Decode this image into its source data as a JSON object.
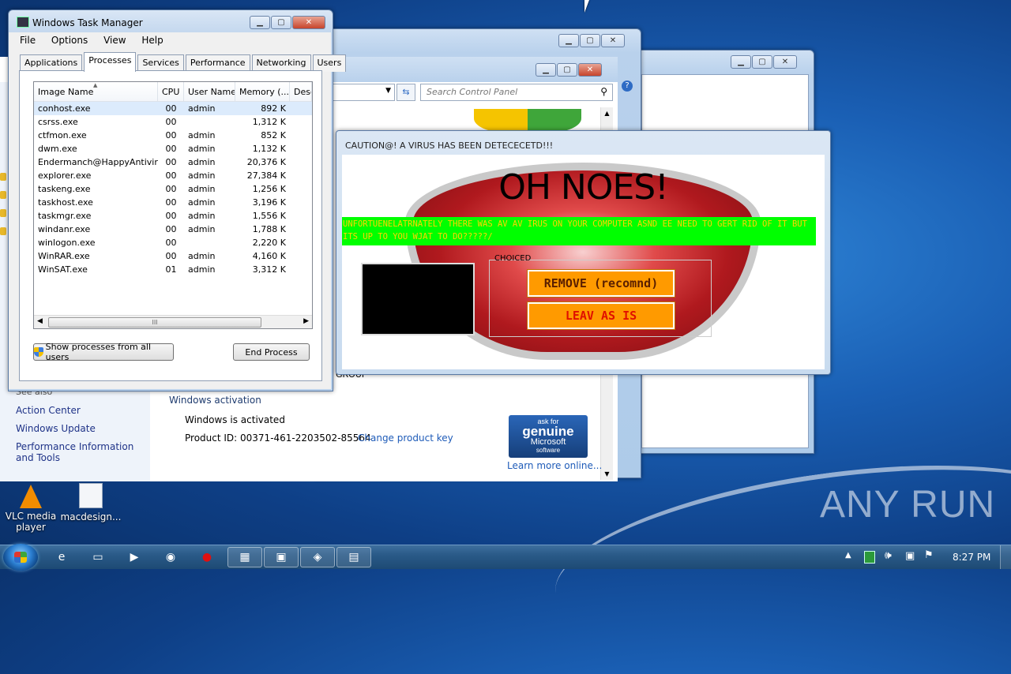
{
  "desktop": {
    "icons": [
      {
        "label": "VLC media player"
      },
      {
        "label": "macdesign..."
      }
    ],
    "watermark": "ANY RUN"
  },
  "control_panel": {
    "search_placeholder": "Search Control Panel",
    "see_also": "See also",
    "sidebar_links": [
      "Action Center",
      "Windows Update",
      "Performance Information and Tools"
    ],
    "workgroup_fragment": "GROUP",
    "activation_heading": "Windows activation",
    "activation_status": "Windows is activated",
    "product_id": "Product ID: 00371-461-2203502-85564",
    "change_key": "Change product key",
    "genuine_badge": {
      "line1": "ask for",
      "line2": "genuine",
      "line3": "Microsoft",
      "line4": "software"
    },
    "learn_more": "Learn more online..."
  },
  "task_manager": {
    "title": "Windows Task Manager",
    "menu": [
      "File",
      "Options",
      "View",
      "Help"
    ],
    "tabs": [
      "Applications",
      "Processes",
      "Services",
      "Performance",
      "Networking",
      "Users"
    ],
    "active_tab": "Processes",
    "columns": [
      "Image Name",
      "CPU",
      "User Name",
      "Memory (...",
      "Desc"
    ],
    "processes": [
      {
        "name": "conhost.exe",
        "cpu": "00",
        "user": "admin",
        "mem": "892 K"
      },
      {
        "name": "csrss.exe",
        "cpu": "00",
        "user": "",
        "mem": "1,312 K"
      },
      {
        "name": "ctfmon.exe",
        "cpu": "00",
        "user": "admin",
        "mem": "852 K"
      },
      {
        "name": "dwm.exe",
        "cpu": "00",
        "user": "admin",
        "mem": "1,132 K"
      },
      {
        "name": "Endermanch@HappyAntivir...",
        "cpu": "00",
        "user": "admin",
        "mem": "20,376 K"
      },
      {
        "name": "explorer.exe",
        "cpu": "00",
        "user": "admin",
        "mem": "27,384 K"
      },
      {
        "name": "taskeng.exe",
        "cpu": "00",
        "user": "admin",
        "mem": "1,256 K"
      },
      {
        "name": "taskhost.exe",
        "cpu": "00",
        "user": "admin",
        "mem": "3,196 K"
      },
      {
        "name": "taskmgr.exe",
        "cpu": "00",
        "user": "admin",
        "mem": "1,556 K"
      },
      {
        "name": "windanr.exe",
        "cpu": "00",
        "user": "admin",
        "mem": "1,788 K"
      },
      {
        "name": "winlogon.exe",
        "cpu": "00",
        "user": "",
        "mem": "2,220 K"
      },
      {
        "name": "WinRAR.exe",
        "cpu": "00",
        "user": "admin",
        "mem": "4,160 K"
      },
      {
        "name": "WinSAT.exe",
        "cpu": "01",
        "user": "admin",
        "mem": "3,312 K"
      }
    ],
    "show_all_label": "Show processes from all users",
    "end_process_label": "End Process",
    "scroll_grip": "III"
  },
  "virus_popup": {
    "title": "CAUTION@! A VIRUS HAS BEEN DETECECETD!!!",
    "headline": "OH NOES!",
    "message": "UNFORTUENELATRNATELY THERE WAS AV AV IRUS ON YOUR COMPUTER ASND EE NEED TO GERT RID OF IT BUT ITS UP TO YOU WJAT TO DO?????/",
    "group_label": "CHOICED",
    "remove_label": "REMOVE (recomnd)",
    "leave_label": "LEAV AS IS",
    "banner_color": "#00ff00",
    "button_color": "#ff9a00"
  },
  "taskbar": {
    "clock": "8:27 PM"
  }
}
